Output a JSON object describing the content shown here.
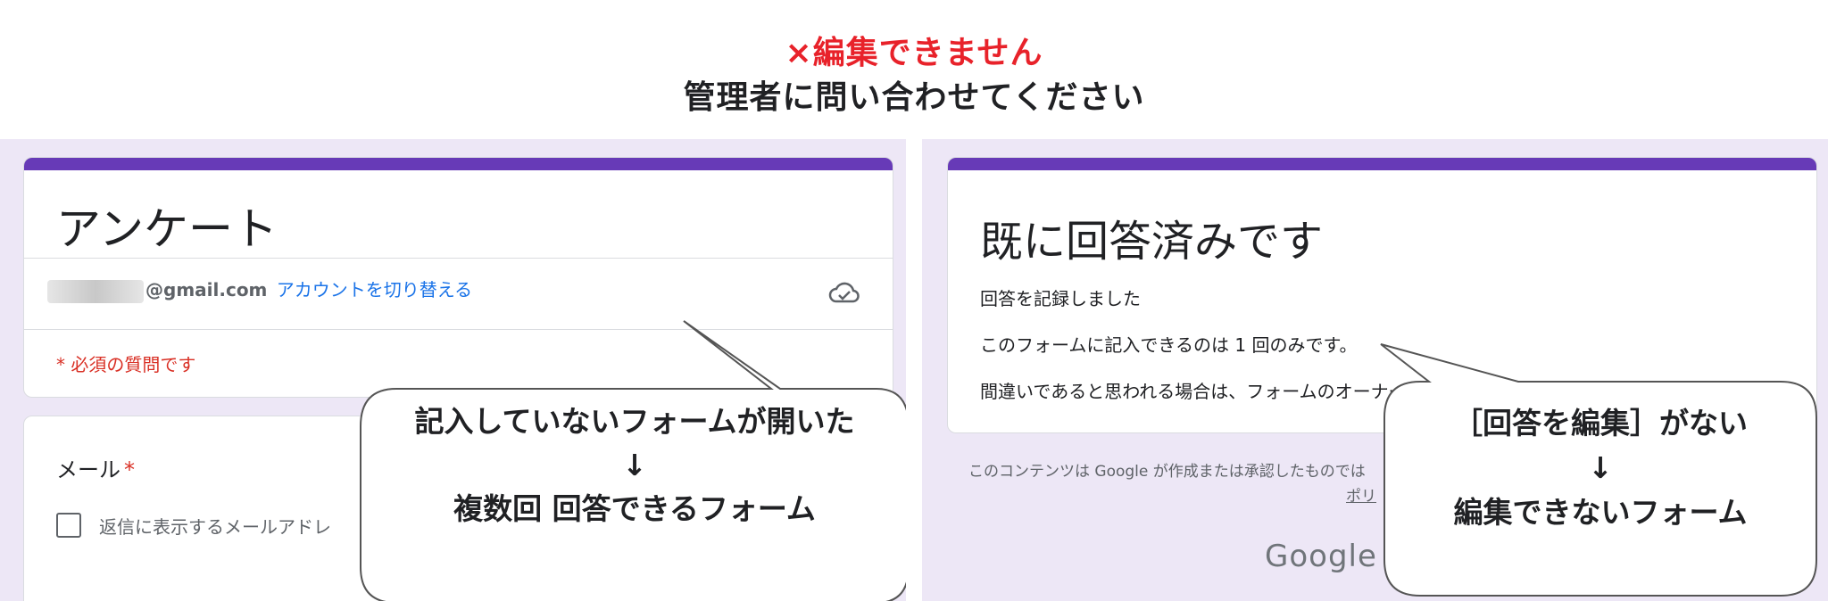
{
  "header": {
    "line1": "×編集できません",
    "line2": "管理者に問い合わせてください"
  },
  "left": {
    "form_title": "アンケート",
    "account_email": "@gmail.com",
    "switch_account": "アカウントを切り替える",
    "required_note": "* 必須の質問です",
    "question_label": "メール",
    "question_required_mark": "*",
    "checkbox_label": "返信に表示するメールアドレ",
    "callout": {
      "line1": "記入していないフォームが開いた",
      "arrow": "↓",
      "line2": "複数回 回答できるフォーム"
    }
  },
  "right": {
    "title": "既に回答済みです",
    "msg1": "回答を記録しました",
    "msg2": "このフォームに記入できるのは 1 回のみです。",
    "msg3": "間違いであると思われる場合は、フォームのオーナーにお問い合わせください。",
    "footer_note": "このコンテンツは Google が作成または承認したものでは",
    "policy_link": "ポリ",
    "google_logo": "Google フ",
    "callout": {
      "line1": "［回答を編集］がない",
      "arrow": "↓",
      "line2": "編集できないフォーム"
    }
  },
  "colors": {
    "accent": "#673ab7",
    "panel_bg": "#ede7f6",
    "header_red": "#e8222a",
    "required_red": "#d93025",
    "link_blue": "#1a73e8"
  },
  "icons": {
    "cloud": "cloud-check-icon",
    "checkbox": "checkbox-icon"
  }
}
